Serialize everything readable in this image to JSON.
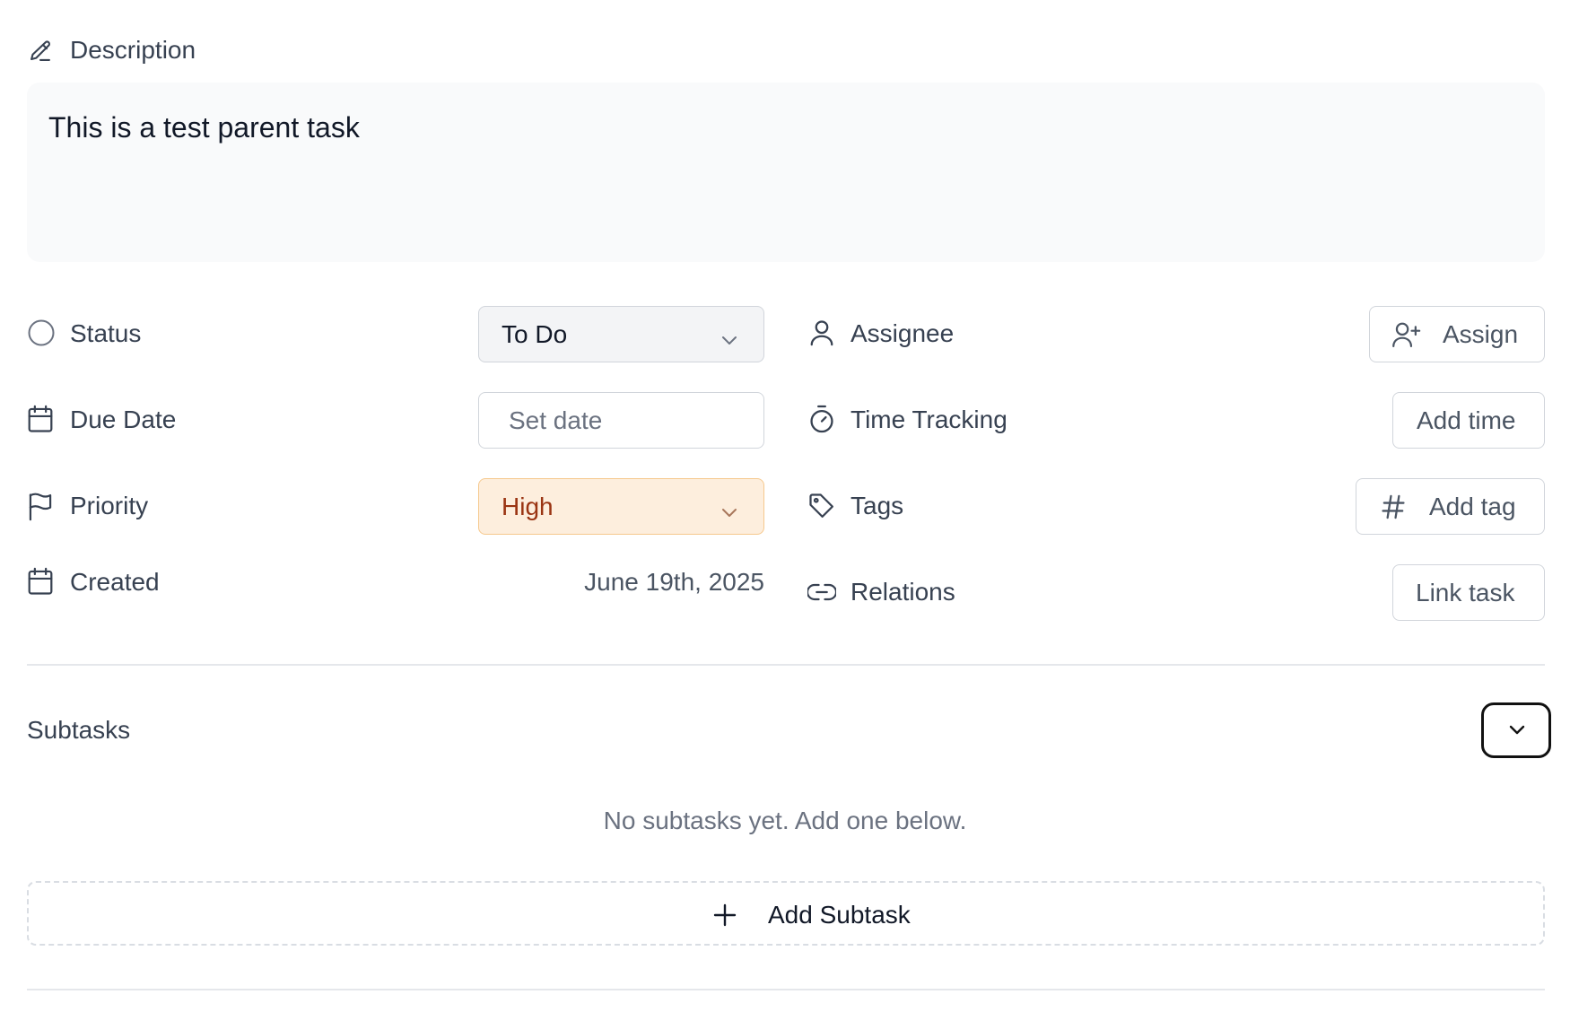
{
  "description": {
    "label": "Description",
    "icon": "pencil-icon",
    "text": "This is a test parent task"
  },
  "properties": {
    "status": {
      "label": "Status",
      "icon": "circle-icon",
      "value": "To Do"
    },
    "due_date": {
      "label": "Due Date",
      "icon": "calendar-icon",
      "placeholder": "Set date"
    },
    "priority": {
      "label": "Priority",
      "icon": "flag-icon",
      "value": "High",
      "color": "#9a3412",
      "background": "#fdeedd"
    },
    "created": {
      "label": "Created",
      "icon": "calendar-icon",
      "value": "June 19th, 2025"
    },
    "assignee": {
      "label": "Assignee",
      "icon": "user-icon",
      "button": "Assign",
      "button_icon": "user-plus-icon"
    },
    "time_tracking": {
      "label": "Time Tracking",
      "icon": "timer-icon",
      "button": "Add time"
    },
    "tags": {
      "label": "Tags",
      "icon": "tag-icon",
      "button": "Add tag",
      "button_icon": "hash-icon"
    },
    "relations": {
      "label": "Relations",
      "icon": "link-icon",
      "button": "Link task"
    }
  },
  "subtasks": {
    "title": "Subtasks",
    "toggle_icon": "chevron-down-icon",
    "empty_text": "No subtasks yet. Add one below.",
    "add_label": "Add Subtask",
    "add_icon": "plus-icon"
  }
}
